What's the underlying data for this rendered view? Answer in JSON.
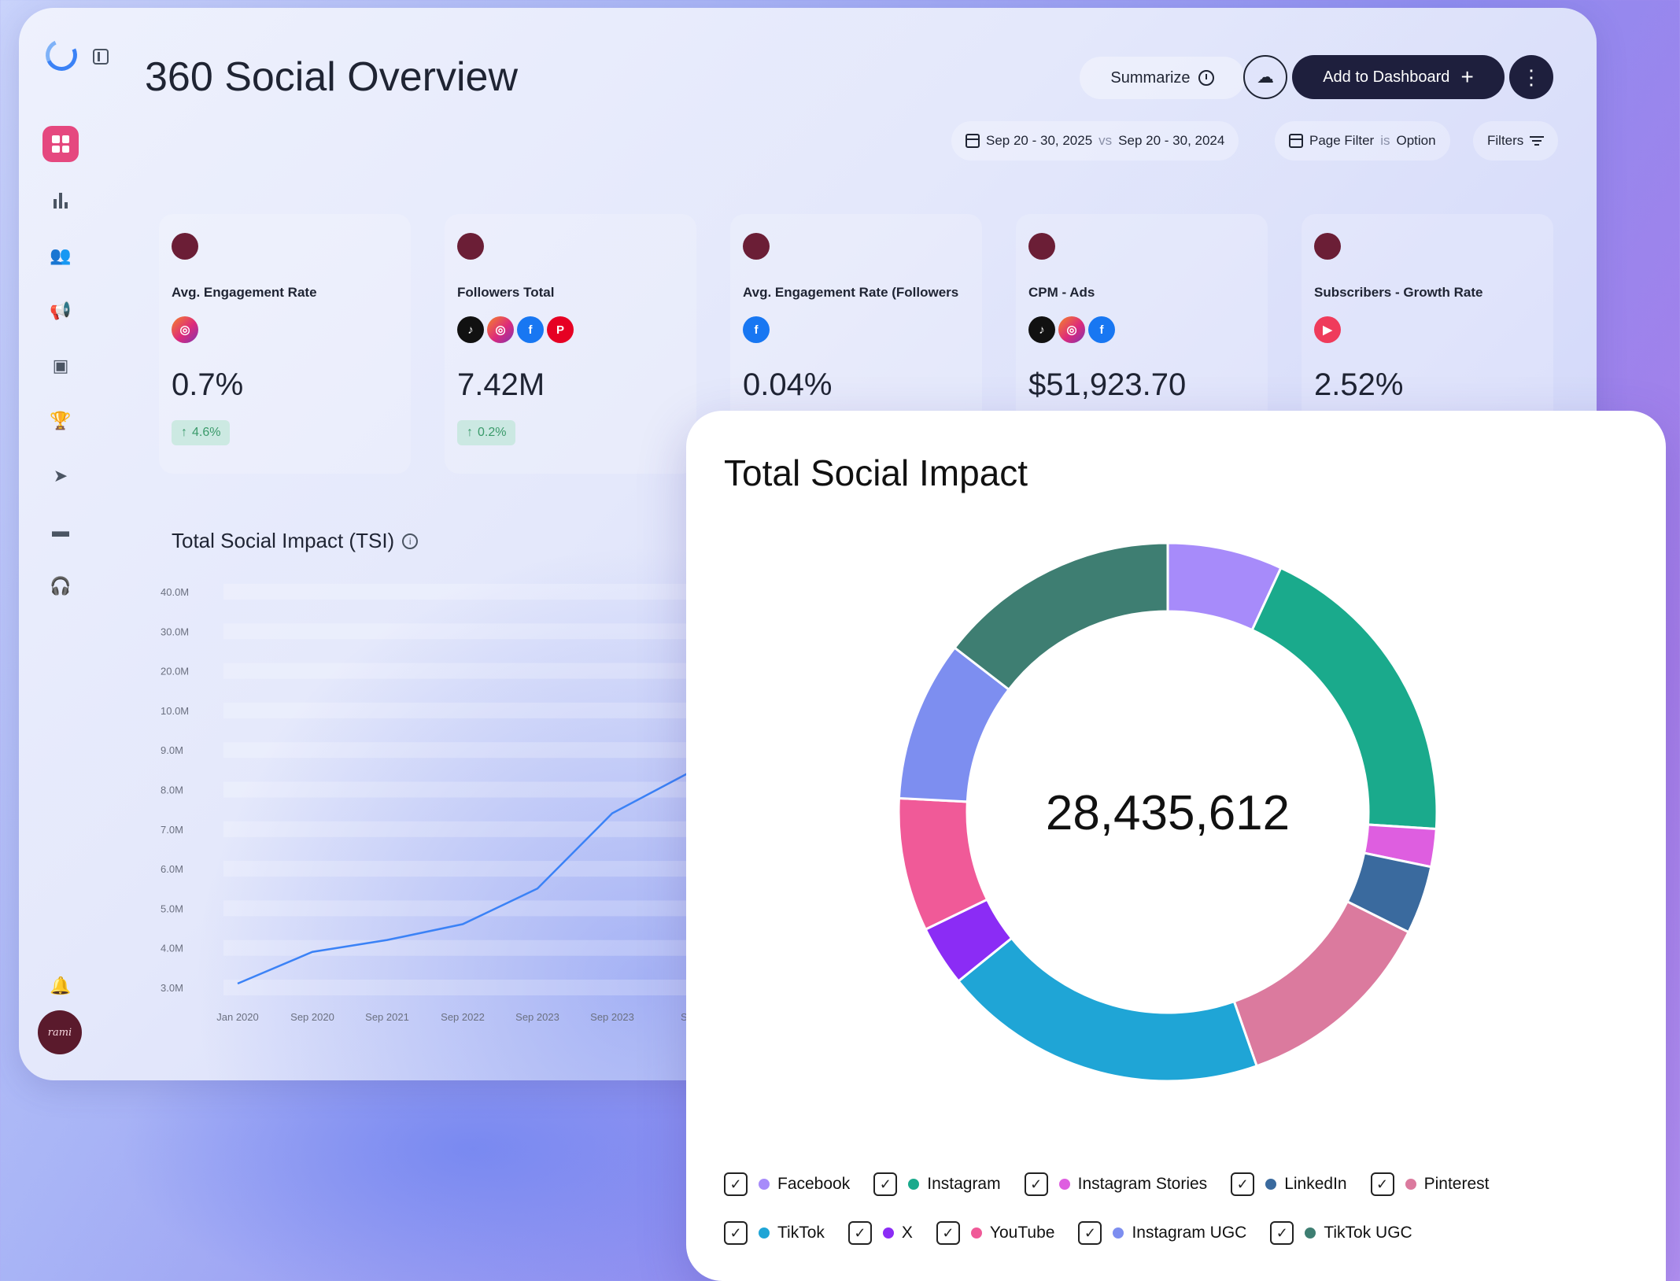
{
  "page": {
    "title": "360 Social Overview"
  },
  "header": {
    "summarize_label": "Summarize",
    "add_label": "Add to Dashboard"
  },
  "filters": {
    "date_range": "Sep 20 - 30, 2025",
    "vs_label": "vs",
    "compare_range": "Sep 20 - 30, 2024",
    "page_filter_label": "Page Filter",
    "is_label": "is",
    "page_filter_value": "Option",
    "filters_label": "Filters"
  },
  "sidebar": {
    "avatar_text": "rami",
    "icons": [
      "dashboard-icon",
      "bar-chart-icon",
      "users-icon",
      "megaphone-icon",
      "chat-icon",
      "trophy-icon",
      "send-icon",
      "folder-icon",
      "headset-icon",
      "bell-icon"
    ]
  },
  "kpis": [
    {
      "label": "Avg. Engagement Rate",
      "value": "0.7%",
      "change": "4.6%",
      "platforms": [
        "instagram"
      ]
    },
    {
      "label": "Followers Total",
      "value": "7.42M",
      "change": "0.2%",
      "platforms": [
        "tiktok",
        "instagram",
        "facebook",
        "pinterest"
      ]
    },
    {
      "label": "Avg. Engagement Rate (Followers",
      "value": "0.04%",
      "change": "",
      "platforms": [
        "facebook"
      ]
    },
    {
      "label": "CPM - Ads",
      "value": "$51,923.70",
      "change": "",
      "platforms": [
        "tiktok",
        "instagram",
        "facebook"
      ]
    },
    {
      "label": "Subscribers - Growth Rate",
      "value": "2.52%",
      "change": "",
      "platforms": [
        "youtube"
      ]
    }
  ],
  "tsi_section": {
    "title": "Total Social Impact (TSI)"
  },
  "chart_data": [
    {
      "type": "line",
      "title": "Total Social Impact (TSI)",
      "yticks": [
        "40.0M",
        "30.0M",
        "20.0M",
        "10.0M",
        "9.0M",
        "8.0M",
        "7.0M",
        "6.0M",
        "5.0M",
        "4.0M",
        "3.0M"
      ],
      "xticks": [
        "Jan 2020",
        "Sep 2020",
        "Sep 2021",
        "Sep 2022",
        "Sep 2023",
        "Sep 2023",
        "Se"
      ],
      "series": [
        {
          "values": [
            3.1,
            3.9,
            4.2,
            4.6,
            5.5,
            7.4,
            8.4
          ]
        }
      ],
      "line_color": "#3b82f6"
    },
    {
      "type": "pie",
      "title": "Total Social Impact",
      "total": "28,435,612",
      "categories": [
        "Facebook",
        "Instagram",
        "Instagram Stories",
        "LinkedIn",
        "Pinterest",
        "TikTok",
        "X",
        "YouTube",
        "Instagram UGC",
        "TikTok UGC"
      ],
      "values": [
        7.6,
        21.0,
        2.5,
        4.5,
        13.5,
        21.5,
        4.0,
        8.8,
        10.6,
        16.0
      ],
      "order": [
        0,
        1,
        2,
        3,
        4,
        5,
        6,
        7,
        8,
        9
      ],
      "colors": [
        "#a78bfa",
        "#1aaa8c",
        "#de5ee0",
        "#3a6a9e",
        "#db7a9e",
        "#1fa5d6",
        "#8b2cf5",
        "#f05a98",
        "#7d8ef0",
        "#3e7e72"
      ]
    }
  ],
  "legend_rows": [
    [
      0,
      1,
      2,
      3,
      4
    ],
    [
      5,
      6,
      7,
      8,
      9
    ]
  ]
}
